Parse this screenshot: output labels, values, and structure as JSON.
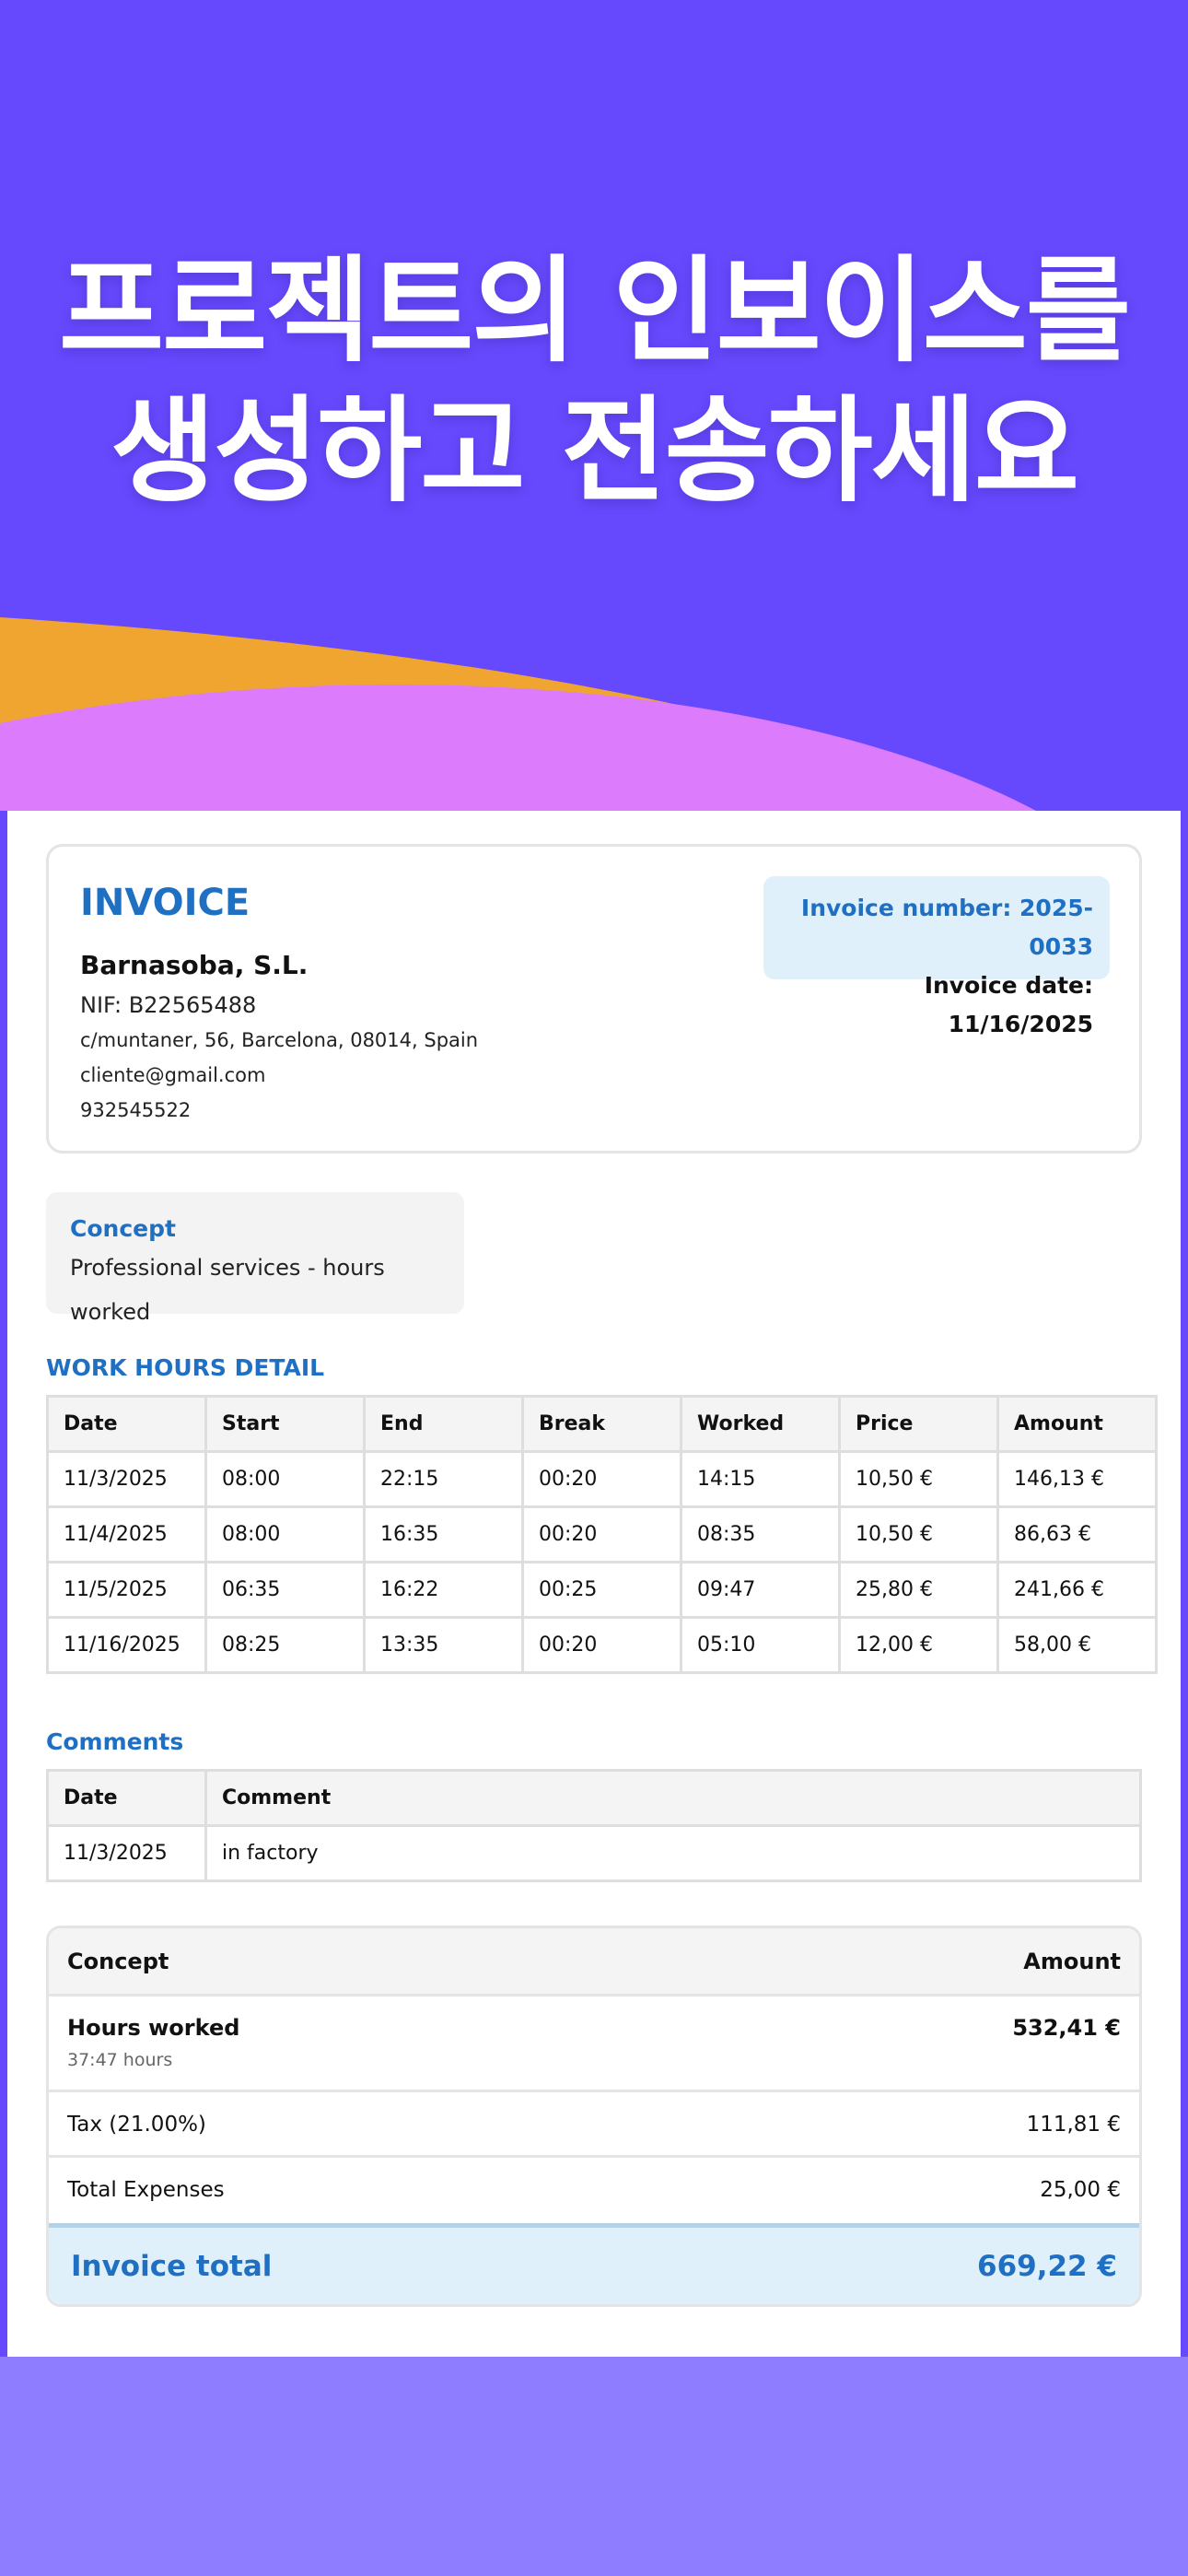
{
  "hero": {
    "title": "프로젝트의 인보이스를\n생성하고 전송하세요"
  },
  "invoice": {
    "title": "INVOICE",
    "company": "Barnasoba, S.L.",
    "nif": "NIF: B22565488",
    "address": "c/muntaner, 56, Barcelona, 08014, Spain",
    "email": "cliente@gmail.com",
    "phone": "932545522",
    "number_label": "Invoice number: 2025-0033",
    "date_label": "Invoice date: 11/16/2025"
  },
  "concept": {
    "label": "Concept",
    "text": "Professional services - hours worked"
  },
  "work_hours": {
    "title": "WORK HOURS DETAIL",
    "headers": [
      "Date",
      "Start",
      "End",
      "Break",
      "Worked",
      "Price",
      "Amount"
    ],
    "rows": [
      [
        "11/3/2025",
        "08:00",
        "22:15",
        "00:20",
        "14:15",
        "10,50 €",
        "146,13 €"
      ],
      [
        "11/4/2025",
        "08:00",
        "16:35",
        "00:20",
        "08:35",
        "10,50 €",
        "86,63 €"
      ],
      [
        "11/5/2025",
        "06:35",
        "16:22",
        "00:25",
        "09:47",
        "25,80 €",
        "241,66 €"
      ],
      [
        "11/16/2025",
        "08:25",
        "13:35",
        "00:20",
        "05:10",
        "12,00 €",
        "58,00 €"
      ]
    ]
  },
  "comments": {
    "title": "Comments",
    "headers": [
      "Date",
      "Comment"
    ],
    "rows": [
      [
        "11/3/2025",
        "in factory"
      ]
    ]
  },
  "summary": {
    "header_concept": "Concept",
    "header_amount": "Amount",
    "hours_label": "Hours worked",
    "hours_sub": "37:47 hours",
    "hours_amount": "532,41 €",
    "tax_label": "Tax (21.00%)",
    "tax_amount": "111,81 €",
    "expenses_label": "Total Expenses",
    "expenses_amount": "25,00 €",
    "total_label": "Invoice total",
    "total_amount": "669,22 €"
  },
  "colors": {
    "background": "#6649fd",
    "accent_blue": "#1f6fc2",
    "wave_orange": "#f0a531",
    "wave_pink": "#dc7bfb"
  }
}
